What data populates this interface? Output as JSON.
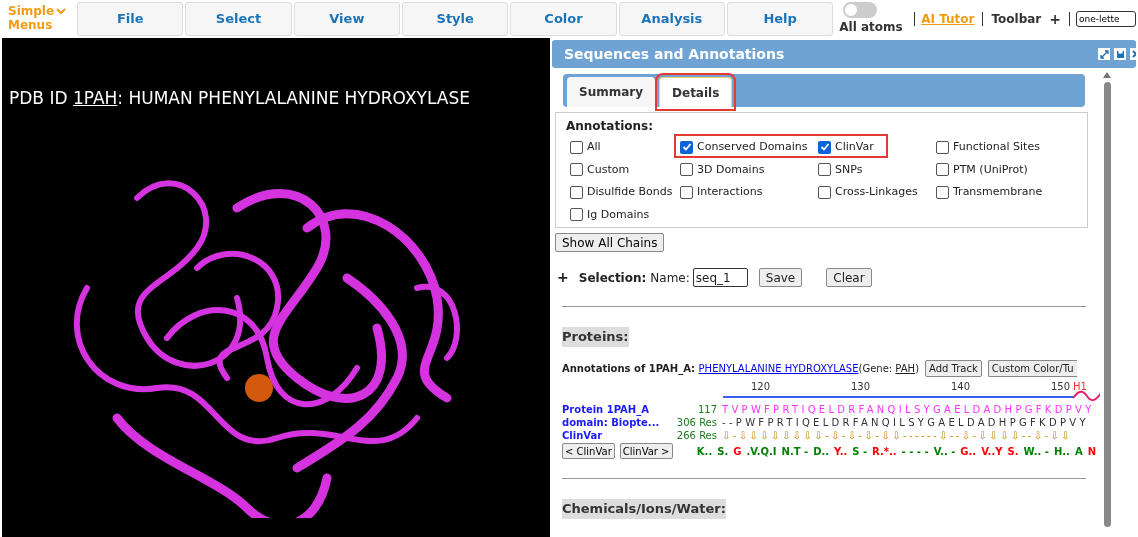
{
  "menu_bar": {
    "simple_menus": "Simple\nMenus",
    "menus": [
      "File",
      "Select",
      "View",
      "Style",
      "Color",
      "Analysis",
      "Help"
    ],
    "all_atoms": {
      "label": "All atoms",
      "on": false
    },
    "ai_tutor": "AI Tutor",
    "toolbar": "Toolbar",
    "plus": "+",
    "field_value": "one-lette"
  },
  "viewer": {
    "title_prefix": "PDB ID ",
    "pdb_id": "1PAH",
    "title_rest": ": HUMAN PHENYLALANINE HYDROXYLASE"
  },
  "panel": {
    "title": "Sequences and Annotations",
    "tabs": [
      {
        "label": "Summary",
        "selected": false
      },
      {
        "label": "Details",
        "selected": true
      }
    ],
    "annotations_label": "Annotations:",
    "annotations": [
      {
        "label": "All",
        "checked": false
      },
      {
        "label": "Conserved Domains",
        "checked": true
      },
      {
        "label": "ClinVar",
        "checked": true
      },
      {
        "label": "Functional Sites",
        "checked": false
      },
      {
        "label": "Custom",
        "checked": false
      },
      {
        "label": "3D Domains",
        "checked": false
      },
      {
        "label": "SNPs",
        "checked": false
      },
      {
        "label": "PTM (UniProt)",
        "checked": false
      },
      {
        "label": "Disulfide Bonds",
        "checked": false
      },
      {
        "label": "Interactions",
        "checked": false
      },
      {
        "label": "Cross-Linkages",
        "checked": false
      },
      {
        "label": "Transmembrane",
        "checked": false
      },
      {
        "label": "Ig Domains",
        "checked": false
      }
    ],
    "show_all_chains": "Show All Chains",
    "selection": {
      "plus": "+",
      "label": "Selection:",
      "name_label": "Name:",
      "name_value": "seq_1",
      "save": "Save",
      "clear": "Clear"
    },
    "proteins_heading": "Proteins:",
    "annotations_of": "Annotations of 1PAH_A: ",
    "protein_link": "PHENYLALANINE HYDROXYLASE",
    "gene_prefix": "(Gene: ",
    "gene": "PAH",
    "gene_suffix": ")",
    "add_track": "Add Track",
    "custom_color": "Custom Color/Tu",
    "ticks": [
      "120",
      "130",
      "140",
      "150"
    ],
    "helix_label": "H1",
    "tracks": [
      {
        "name": "Protein 1PAH_A",
        "count": "117",
        "kind": "protein",
        "sequence": "TVPWFPRTIQELDRFANQILSYGAELDADHPGFKDPVY"
      },
      {
        "name": "domain: Biopte...",
        "count": "306 Res",
        "kind": "domain",
        "sequence": "--PWFPRTIQELDRFANQILSYGAELDADHPGFKDPVY"
      },
      {
        "name": "ClinVar",
        "count": "266 Res",
        "kind": "clinvar",
        "sequence": "⇩-⇩⇩⇩⇩⇩⇩⇩⇩-⇩-⇩-⇩-⇩⇩------⇩--⇩-⇩⇩⇩⇩--⇩-⇩⇩"
      }
    ],
    "clinvar_prev": "< ClinVar",
    "clinvar_next": "ClinVar >",
    "variants": [
      {
        "text": "K..",
        "color": "#008000"
      },
      {
        "text": "S.",
        "color": "#008000"
      },
      {
        "text": "G",
        "color": "#ff0000"
      },
      {
        "text": ".V.Q.I",
        "color": "#008000"
      },
      {
        "text": "N.T -",
        "color": "#008000"
      },
      {
        "text": "D..",
        "color": "#008000"
      },
      {
        "text": "Y..",
        "color": "#ff0000"
      },
      {
        "text": "S -",
        "color": "#008000"
      },
      {
        "text": "R.*..",
        "color": "#ff0000"
      },
      {
        "text": "- - - -",
        "color": "#008000"
      },
      {
        "text": "V.. -",
        "color": "#008000"
      },
      {
        "text": "G..",
        "color": "#ff0000"
      },
      {
        "text": "V..Y",
        "color": "#ff0000"
      },
      {
        "text": "S.",
        "color": "#ff0000"
      },
      {
        "text": "W.. -",
        "color": "#008000"
      },
      {
        "text": "H..",
        "color": "#008000"
      },
      {
        "text": "A",
        "color": "#008000"
      },
      {
        "text": "N",
        "color": "#ff0000"
      }
    ],
    "chemicals_heading": "Chemicals/Ions/Water:"
  }
}
